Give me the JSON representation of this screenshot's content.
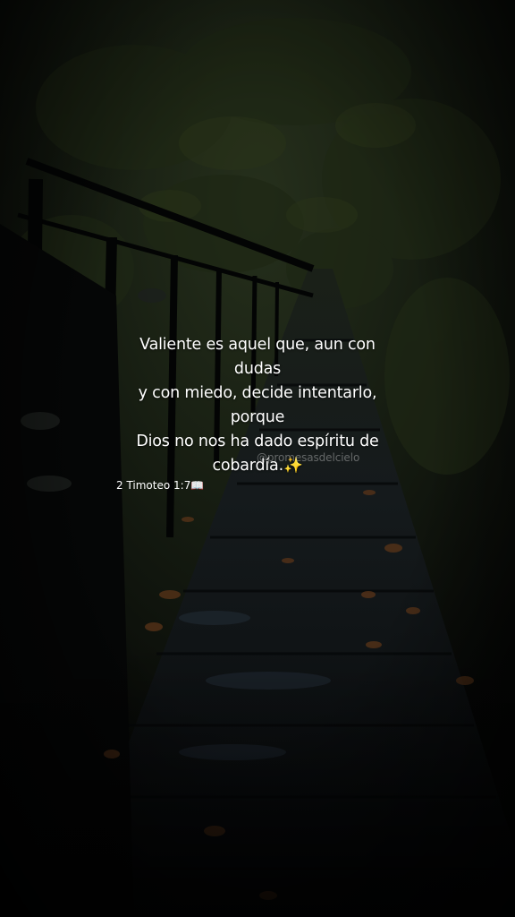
{
  "story": {
    "quote_lines": [
      "Valiente es aquel que, aun con",
      "dudas",
      "y con miedo, decide intentarlo,",
      "porque",
      "Dios no nos ha dado espíritu de",
      "cobardía.✨"
    ],
    "watermark": "@promesasdelcielo",
    "reference": "2 Timoteo 1:7📖"
  },
  "background": {
    "description_colors": {
      "foliage": "#1c2316",
      "boardwalk": "#101316",
      "leaf": "#5a3418",
      "shade": "#000000"
    }
  }
}
